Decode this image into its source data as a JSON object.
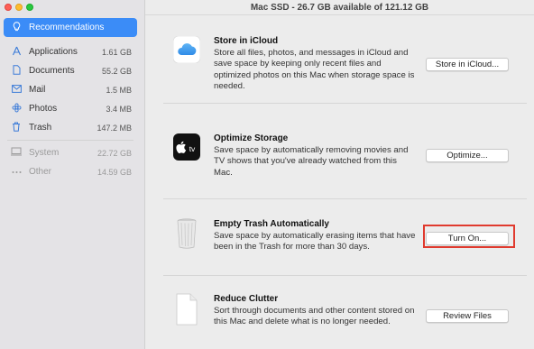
{
  "window": {
    "title": "Mac SSD - 26.7 GB available of 121.12 GB"
  },
  "sidebar": {
    "items": [
      {
        "label": "Recommendations",
        "size": "",
        "icon": "lightbulb-icon",
        "selected": true
      },
      {
        "label": "Applications",
        "size": "1.61 GB",
        "icon": "applications-icon"
      },
      {
        "label": "Documents",
        "size": "55.2 GB",
        "icon": "document-icon"
      },
      {
        "label": "Mail",
        "size": "1.5 MB",
        "icon": "mail-icon"
      },
      {
        "label": "Photos",
        "size": "3.4 MB",
        "icon": "photos-icon"
      },
      {
        "label": "Trash",
        "size": "147.2 MB",
        "icon": "trash-icon"
      },
      {
        "label": "System",
        "size": "22.72 GB",
        "icon": "computer-icon",
        "dim": true
      },
      {
        "label": "Other",
        "size": "14.59 GB",
        "icon": "ellipsis-icon",
        "dim": true
      }
    ]
  },
  "recommendations": [
    {
      "title": "Store in iCloud",
      "desc": "Store all files, photos, and messages in iCloud and save space by keeping only recent files and optimized photos on this Mac when storage space is needed.",
      "button": "Store in iCloud...",
      "icon": "icloud-icon"
    },
    {
      "title": "Optimize Storage",
      "desc": "Save space by automatically removing movies and TV shows that you've already watched from this Mac.",
      "button": "Optimize...",
      "icon": "apple-tv-icon",
      "icon_text": "tv"
    },
    {
      "title": "Empty Trash Automatically",
      "desc": "Save space by automatically erasing items that have been in the Trash for more than 30 days.",
      "button": "Turn On...",
      "icon": "trash-can-icon",
      "highlighted": true
    },
    {
      "title": "Reduce Clutter",
      "desc": "Sort through documents and other content stored on this Mac and delete what is no longer needed.",
      "button": "Review Files",
      "icon": "document-icon"
    }
  ],
  "colors": {
    "accent": "#3b8cf7",
    "highlight": "#e03a2e"
  }
}
